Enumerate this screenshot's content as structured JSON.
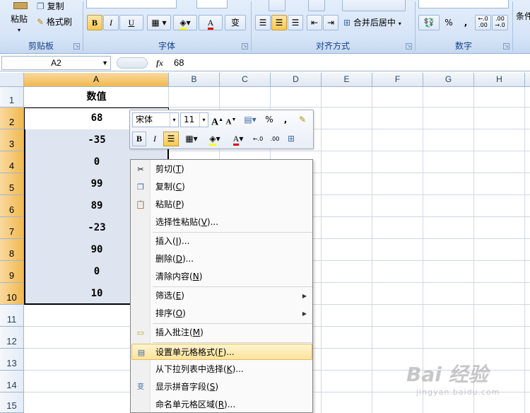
{
  "ribbon": {
    "clipboard": {
      "group_label": "剪贴板",
      "paste_label": "粘贴",
      "copy_label": "复制",
      "format_painter_label": "格式刷"
    },
    "font": {
      "group_label": "字体",
      "bold": "B",
      "italic": "I",
      "underline": "U",
      "font_color_glyph": "A",
      "phonetic_glyph": "变"
    },
    "alignment": {
      "group_label": "对齐方式",
      "merge_label": "合并后居中"
    },
    "number": {
      "group_label": "数字",
      "percent": "%",
      "comma": ",",
      "inc_decimal": "←.0 .00",
      "dec_decimal": ".00 →.0"
    },
    "styles": {
      "partial_label": "条件"
    }
  },
  "formula_bar": {
    "name_box": "A2",
    "fx": "fx",
    "content": "68"
  },
  "grid": {
    "columns": [
      "A",
      "B",
      "C",
      "D",
      "E",
      "F",
      "G",
      "H"
    ],
    "rows": [
      "1",
      "2",
      "3",
      "4",
      "5",
      "6",
      "7",
      "8",
      "9",
      "10",
      "11",
      "12",
      "13",
      "14",
      "15"
    ],
    "header_value": "数值",
    "values": [
      "68",
      "-35",
      "0",
      "99",
      "89",
      "-23",
      "90",
      "0",
      "10"
    ]
  },
  "mini_toolbar": {
    "font_name": "宋体",
    "font_size": "11",
    "grow_font": "A",
    "shrink_font": "A",
    "percent": "%",
    "comma": ",",
    "bold": "B",
    "italic": "I",
    "font_color_glyph": "A",
    "inc_decimal": "←.0",
    "dec_decimal": ".00"
  },
  "context_menu": {
    "items": [
      {
        "label": "剪切",
        "key": "T"
      },
      {
        "label": "复制",
        "key": "C"
      },
      {
        "label": "粘贴",
        "key": "P"
      },
      {
        "label": "选择性粘贴",
        "key": "V",
        "suffix": "..."
      },
      {
        "label": "插入",
        "key": "I",
        "suffix": "..."
      },
      {
        "label": "删除",
        "key": "D",
        "suffix": "..."
      },
      {
        "label": "清除内容",
        "key": "N"
      },
      {
        "label": "筛选",
        "key": "E"
      },
      {
        "label": "排序",
        "key": "O"
      },
      {
        "label": "插入批注",
        "key": "M"
      },
      {
        "label": "设置单元格格式",
        "key": "F",
        "suffix": "..."
      },
      {
        "label": "从下拉列表中选择",
        "key": "K",
        "suffix": "..."
      },
      {
        "label": "显示拼音字段",
        "key": "S"
      },
      {
        "label": "命名单元格区域",
        "key": "R",
        "suffix": "..."
      }
    ]
  },
  "watermark": {
    "brand": "Bai 经验",
    "url": "jingyan.baidu.com"
  }
}
